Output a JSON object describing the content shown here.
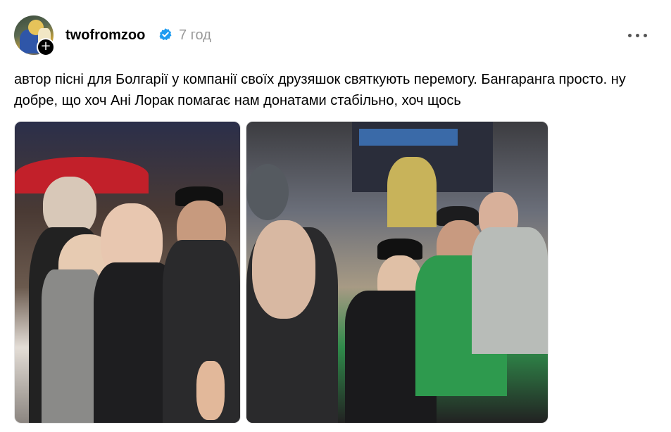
{
  "post": {
    "username": "twofromzoo",
    "timestamp": "7 год",
    "caption": "автор пісні для Болгарії у компанії своїх друзяшок святкують перемогу. Бангаранга просто. ну добре, що хоч Ані Лорак помагає нам донатами стабільно, хоч щось",
    "follow_symbol": "+",
    "verified_color": "#1d9bf0",
    "icons": [
      "verified-badge-icon",
      "more-options-icon",
      "follow-plus-icon"
    ],
    "photos": [
      {
        "name": "photo-1"
      },
      {
        "name": "photo-2"
      }
    ]
  }
}
